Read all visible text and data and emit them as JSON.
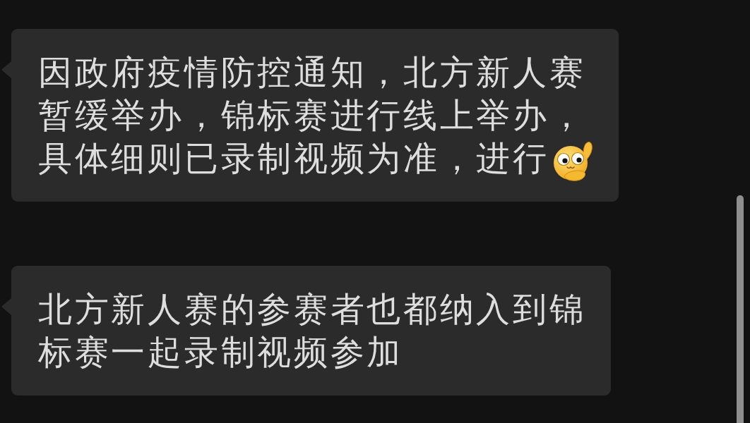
{
  "messages": [
    {
      "lines": [
        "因政府疫情防控通知，北方新人赛",
        "暂缓举办，锦标赛进行线上举办，",
        "具体细则已录制视频为准，进行"
      ],
      "has_emoji": true
    },
    {
      "lines": [
        "北方新人赛的参赛者也都纳入到锦",
        "标赛一起录制视频参加"
      ],
      "has_emoji": false
    }
  ]
}
